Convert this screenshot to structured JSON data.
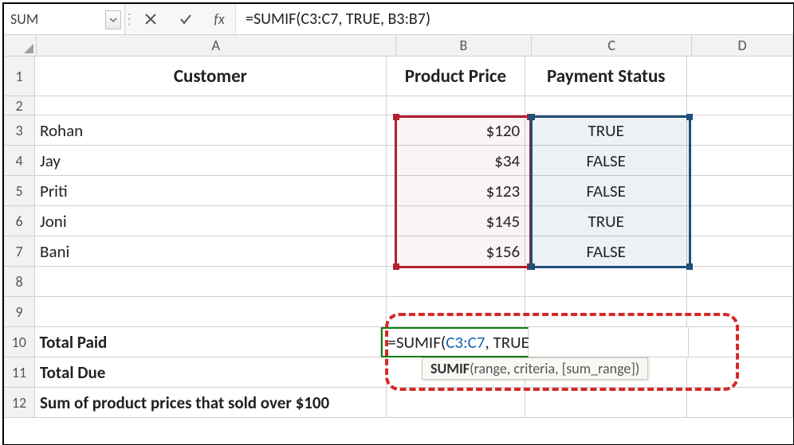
{
  "nameBox": "SUM",
  "formulaBar": "=SUMIF(C3:C7, TRUE, B3:B7)",
  "fxLabel": "fx",
  "columns": [
    "A",
    "B",
    "C",
    "D"
  ],
  "headers": {
    "A": "Customer",
    "B": "Product Price",
    "C": "Payment Status"
  },
  "dataRows": [
    {
      "n": 3,
      "A": "Rohan",
      "B": "$120",
      "C": "TRUE"
    },
    {
      "n": 4,
      "A": "Jay",
      "B": "$34",
      "C": "FALSE"
    },
    {
      "n": 5,
      "A": "Priti",
      "B": "$123",
      "C": "FALSE"
    },
    {
      "n": 6,
      "A": "Joni",
      "B": "$145",
      "C": "TRUE"
    },
    {
      "n": 7,
      "A": "Bani",
      "B": "$156",
      "C": "FALSE"
    }
  ],
  "summaryRows": {
    "r10": "Total Paid",
    "r11": "Total Due",
    "r12": "Sum of product prices that sold over $100"
  },
  "activeFormula": {
    "prefix": "=SUMIF(",
    "ref1": "C3:C7",
    "mid": ", TRUE, ",
    "ref2": "B3:B7",
    "suffix": ")"
  },
  "tooltip": {
    "fn": "SUMIF",
    "sig": "(range, criteria, [sum_range])"
  },
  "rowNums": [
    1,
    2,
    3,
    4,
    5,
    6,
    7,
    8,
    9,
    10,
    11,
    12
  ]
}
